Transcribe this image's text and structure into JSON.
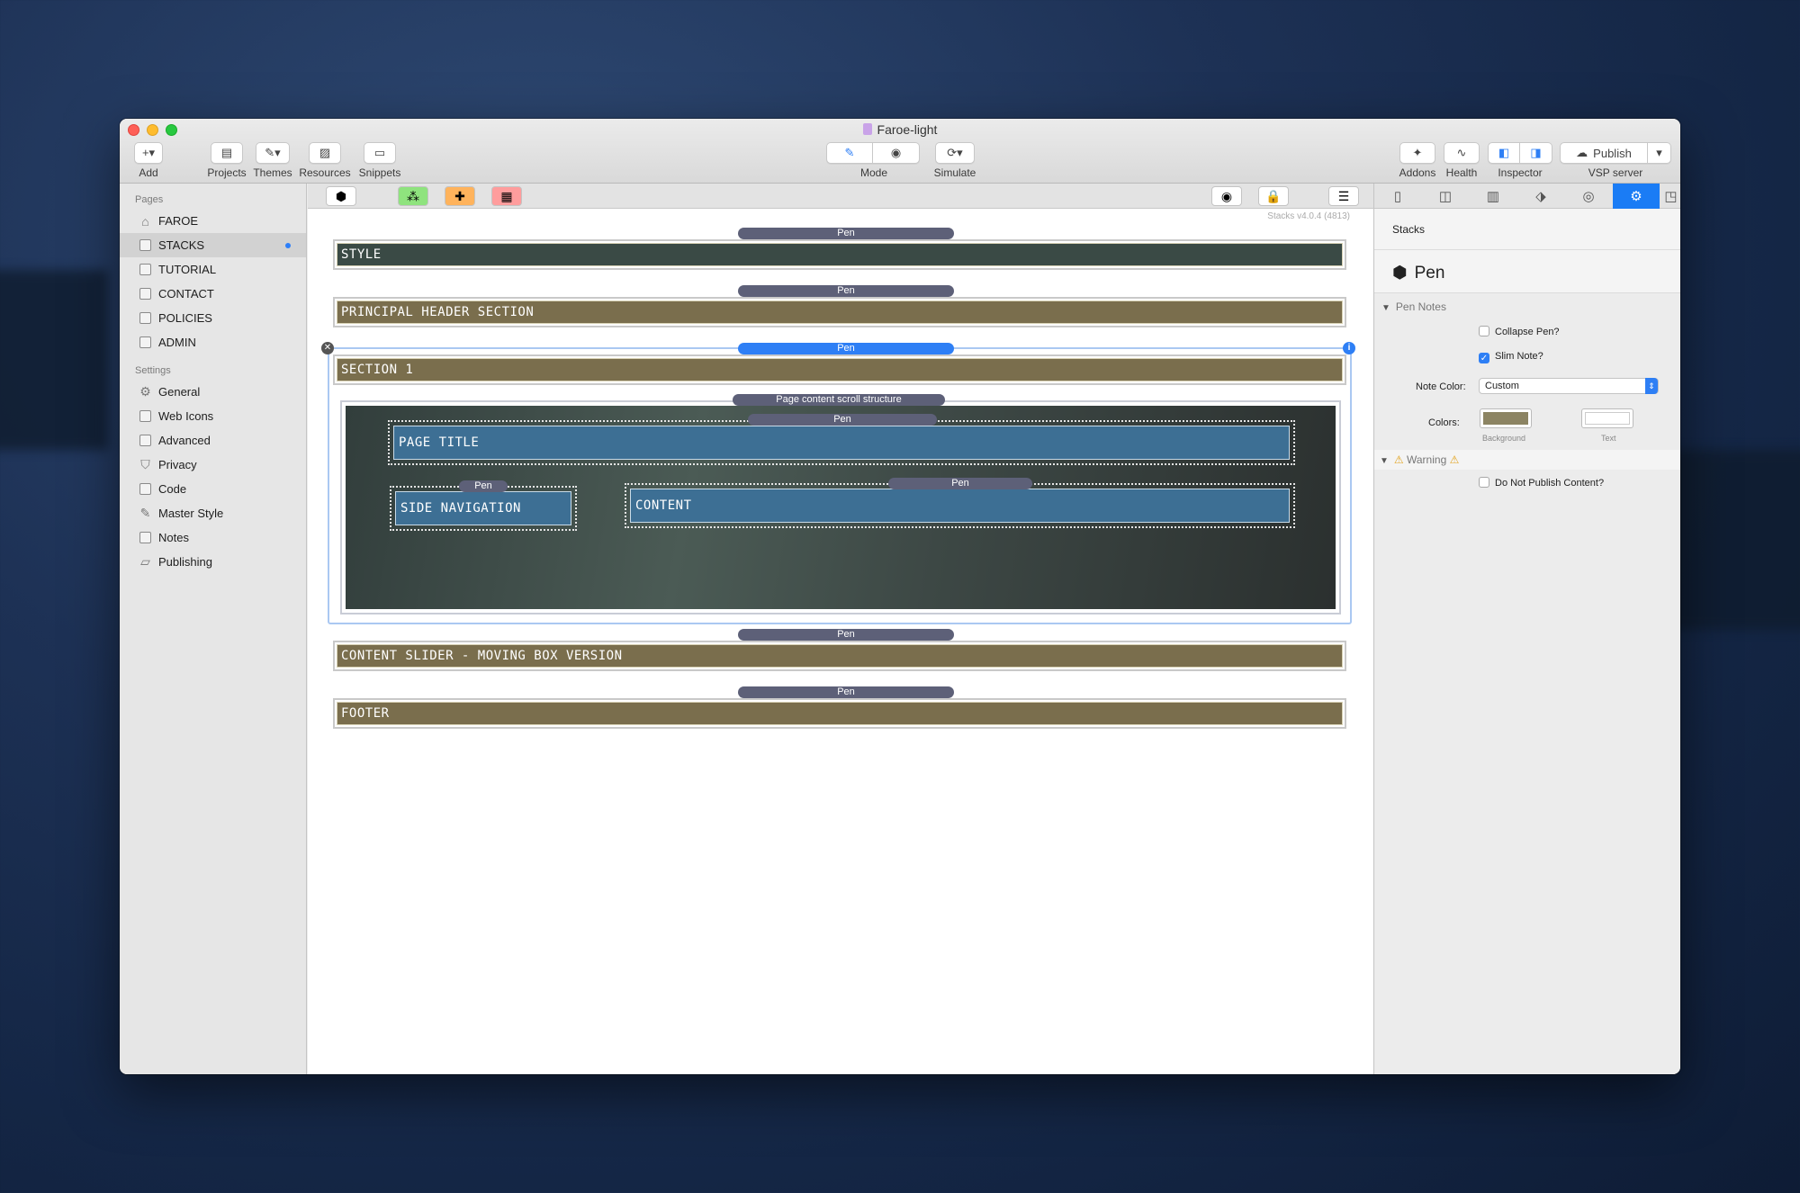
{
  "window": {
    "title": "Faroe-light"
  },
  "toolbar": {
    "add": "Add",
    "projects": "Projects",
    "themes": "Themes",
    "resources": "Resources",
    "snippets": "Snippets",
    "mode": "Mode",
    "simulate": "Simulate",
    "addons": "Addons",
    "health": "Health",
    "inspector": "Inspector",
    "publish_button": "Publish",
    "publish_target": "VSP server"
  },
  "sidebar": {
    "pages_header": "Pages",
    "pages": [
      {
        "label": "FAROE",
        "icon": "home-icon"
      },
      {
        "label": "STACKS",
        "icon": "page-icon",
        "active": true,
        "dot": true
      },
      {
        "label": "TUTORIAL",
        "icon": "page-icon"
      },
      {
        "label": "CONTACT",
        "icon": "page-icon"
      },
      {
        "label": "POLICIES",
        "icon": "page-icon"
      },
      {
        "label": "ADMIN",
        "icon": "page-icon"
      }
    ],
    "settings_header": "Settings",
    "settings": [
      {
        "label": "General",
        "icon": "gear-icon"
      },
      {
        "label": "Web Icons",
        "icon": "image-icon"
      },
      {
        "label": "Advanced",
        "icon": "advanced-icon"
      },
      {
        "label": "Privacy",
        "icon": "shield-icon"
      },
      {
        "label": "Code",
        "icon": "code-icon"
      },
      {
        "label": "Master Style",
        "icon": "brush-icon"
      },
      {
        "label": "Notes",
        "icon": "notes-icon"
      },
      {
        "label": "Publishing",
        "icon": "folder-icon"
      }
    ]
  },
  "editor": {
    "version": "Stacks v4.0.4 (4813)",
    "pen_label": "Pen",
    "scroll_label": "Page content scroll structure",
    "bands": {
      "style": "STYLE",
      "header": "PRINCIPAL HEADER SECTION",
      "section1": "SECTION 1",
      "slider": "CONTENT SLIDER - MOVING BOX VERSION",
      "footer": "FOOTER"
    },
    "inner": {
      "page_title": "PAGE TITLE",
      "side_nav": "SIDE NAVIGATION",
      "content": "CONTENT"
    },
    "colors": {
      "olive": "#7a6e4d",
      "slate": "#3a4a45",
      "blue": "#3d6f94",
      "pen": "#5d6078",
      "selected": "#2e7ff5"
    }
  },
  "inspector": {
    "header": "Stacks",
    "stack_name": "Pen",
    "pen_notes": "Pen Notes",
    "collapse_pen": "Collapse Pen?",
    "collapse_checked": false,
    "slim_note": "Slim Note?",
    "slim_checked": true,
    "note_color_label": "Note Color:",
    "note_color_value": "Custom",
    "colors_label": "Colors:",
    "bg_label": "Background",
    "text_label": "Text",
    "bg_color": "#8c8463",
    "text_color": "#ffffff",
    "warning": "Warning",
    "do_not_publish": "Do Not Publish Content?",
    "do_not_publish_checked": false
  }
}
